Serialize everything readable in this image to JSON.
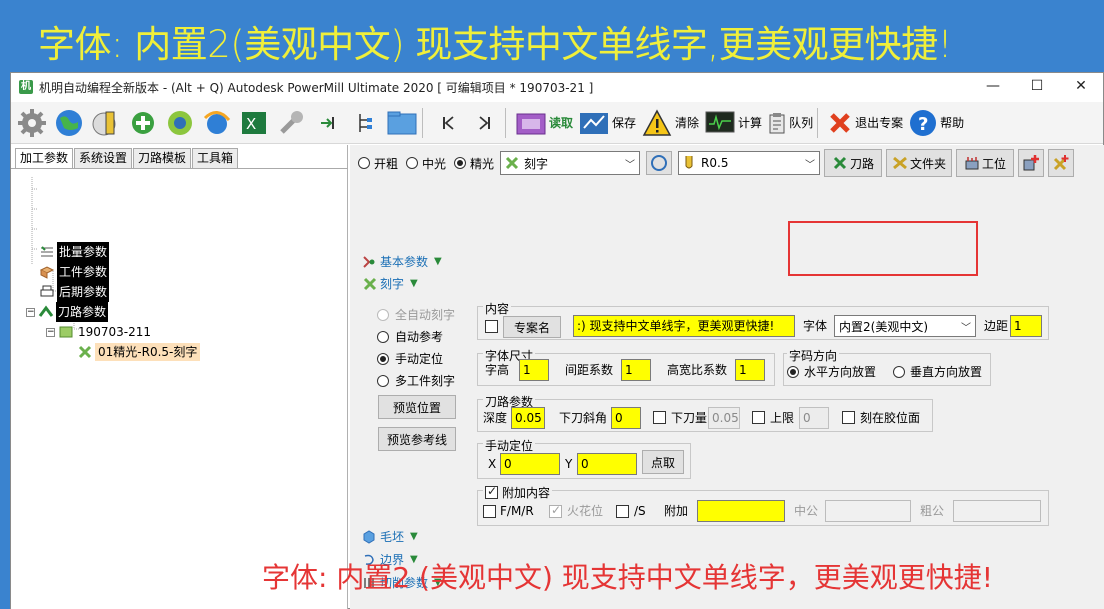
{
  "banner": "字体: 内置2(美观中文) 现支持中文单线字,更美观更快捷!",
  "window": {
    "title": "机明自动编程全新版本 - (Alt + Q) Autodesk PowerMill Ultimate 2020    [ 可编辑项目 * 190703-21 ]",
    "controls": {
      "minimize": "—",
      "maximize": "☐",
      "close": "✕"
    }
  },
  "toolbar": {
    "load": "读取",
    "save": "保存",
    "clear": "清除",
    "calc": "计算",
    "queue": "队列",
    "exit_expert": "退出专案",
    "help": "帮助"
  },
  "left": {
    "tabs": [
      "加工参数",
      "系统设置",
      "刀路模板",
      "工具箱"
    ],
    "tree": {
      "batch": "批量参数",
      "workpiece": "工件参数",
      "post": "后期参数",
      "toolpath": "刀路参数",
      "project": "190703-211",
      "item": "01精光-R0.5-刻字"
    }
  },
  "right": {
    "mode": {
      "rough": "开粗",
      "medium": "中光",
      "finish": "精光",
      "selected": "finish"
    },
    "strategy": "刻字",
    "tool": "R0.5",
    "buttons": {
      "toolpath": "刀路",
      "folder": "文件夹",
      "workstation": "工位"
    },
    "sections": {
      "basic": "基本参数",
      "engrave": "刻字",
      "blank": "毛坯",
      "boundary": "边界",
      "cutting": "切削参数"
    },
    "options": {
      "auto_engrave": "全自动刻字",
      "auto_ref": "自动参考",
      "manual_pos": "手动定位",
      "multi_work": "多工件刻字",
      "selected": "manual_pos"
    },
    "preview_pos": "预览位置",
    "preview_ref": "预览参考线",
    "content": {
      "title": "内容",
      "project_name_btn": "专案名",
      "text": ":)   现支持中文单线字，更美观更快捷!",
      "font_label": "字体",
      "font_value": "内置2(美观中文)",
      "margin_label": "边距",
      "margin_value": "1"
    },
    "size": {
      "title": "字体尺寸",
      "height_label": "字高",
      "height": "1",
      "spacing_label": "间距系数",
      "spacing": "1",
      "ratio_label": "高宽比系数",
      "ratio": "1"
    },
    "direction": {
      "title": "字码方向",
      "horizontal": "水平方向放置",
      "vertical": "垂直方向放置",
      "selected": "horizontal"
    },
    "toolpath_params": {
      "title": "刀路参数",
      "depth_label": "深度",
      "depth": "0.05",
      "ramp_label": "下刀斜角",
      "ramp": "0",
      "plunge_label": "下刀量",
      "plunge": "0.05",
      "upper_label": "上限",
      "upper": "0",
      "on_glue_label": "刻在胶位面"
    },
    "manual": {
      "title": "手动定位",
      "x_label": "X",
      "x": "0",
      "y_label": "Y",
      "y": "0",
      "pick": "点取"
    },
    "extra": {
      "title": "附加内容",
      "fmr": "F/M/R",
      "spark": "火花位",
      "slash_s": "/S",
      "add_label": "附加",
      "add": "",
      "male_label": "中公",
      "male": "",
      "group_label": "粗公",
      "group": ""
    }
  },
  "caption": "字体: 内置2 (美观中文)   现支持中文单线字，更美观更快捷!",
  "colors": {
    "highlight_field": "#ffff00",
    "annotation_red": "#e53535",
    "banner_yellow": "#f0ef3a",
    "background_blue": "#3a83cf"
  }
}
